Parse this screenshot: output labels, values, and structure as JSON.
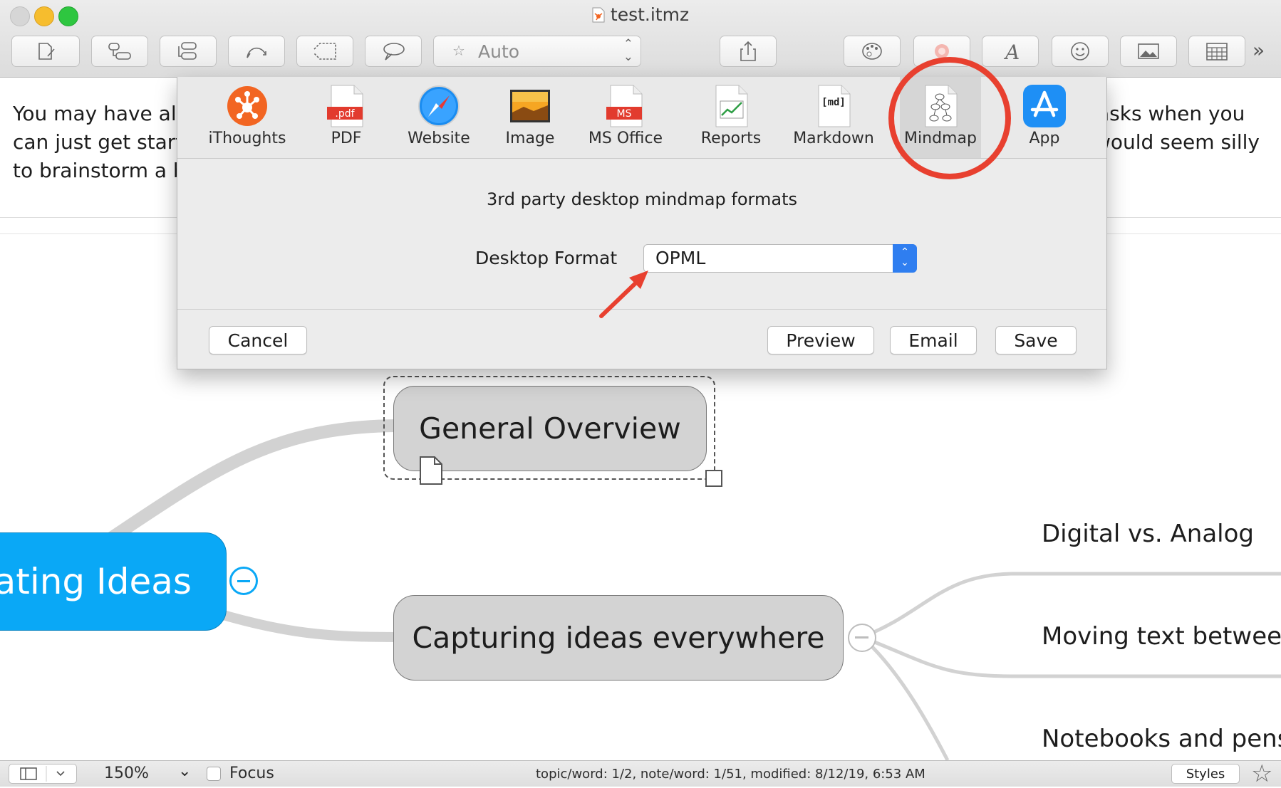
{
  "window": {
    "title": "test.itmz"
  },
  "toolbar": {
    "style_select": "Auto",
    "more": "»"
  },
  "notes": {
    "left_lines": [
      "You may have alr",
      "can just get starte",
      "to brainstorm a b"
    ],
    "right_lines": [
      "asks when you",
      "would seem silly"
    ]
  },
  "export": {
    "formats": [
      {
        "label": "iThoughts"
      },
      {
        "label": "PDF",
        "badge": ".pdf"
      },
      {
        "label": "Website"
      },
      {
        "label": "Image"
      },
      {
        "label": "MS Office",
        "badge": "MS"
      },
      {
        "label": "Reports"
      },
      {
        "label": "Markdown",
        "badge": "[md]"
      },
      {
        "label": "Mindmap",
        "selected": true
      },
      {
        "label": "App"
      }
    ],
    "description": "3rd party desktop mindmap formats",
    "desktop_format_label": "Desktop Format",
    "desktop_format_value": "OPML",
    "buttons": {
      "cancel": "Cancel",
      "preview": "Preview",
      "email": "Email",
      "save": "Save"
    }
  },
  "mindmap": {
    "central": "ating Ideas",
    "general_overview": "General Overview",
    "capturing": "Capturing ideas everywhere",
    "leaves": [
      "Digital vs. Analog",
      "Moving text betweer",
      "Notebooks and pens"
    ]
  },
  "statusbar": {
    "zoom": "150%",
    "focus": "Focus",
    "info": "topic/word: 1/2, note/word: 1/51, modified: 8/12/19, 6:53 AM",
    "styles": "Styles"
  },
  "colors": {
    "accent_blue": "#0aa8f6",
    "select_blue": "#2f7ef0",
    "annotation_red": "#e8402f"
  }
}
